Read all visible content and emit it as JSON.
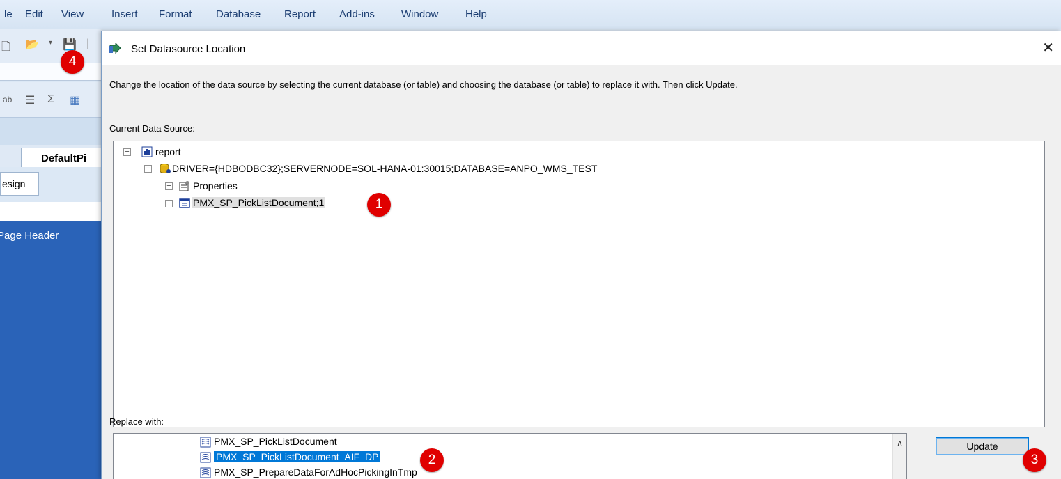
{
  "menu": [
    "le",
    "Edit",
    "View",
    "Insert",
    "Format",
    "Database",
    "Report",
    "Add-ins",
    "Window",
    "Help"
  ],
  "background_app": {
    "doc_tab": "DefaultPi",
    "design_tab": "esign",
    "section_label": "Page Header"
  },
  "dialog": {
    "title": "Set Datasource Location",
    "close_symbol": "✕",
    "description": "Change the location of the data source by selecting the current database (or table) and choosing the database (or table) to replace it with.  Then click Update.",
    "current_label": "Current Data Source:",
    "tree": {
      "root": "report",
      "connection": "DRIVER={HDBODBC32};SERVERNODE=SOL-HANA-01:30015;DATABASE=ANPO_WMS_TEST",
      "properties": "Properties",
      "table": "PMX_SP_PickListDocument;1"
    },
    "replace_label": "Replace with:",
    "replace_items": [
      "PMX_SP_PickListDocument",
      "PMX_SP_PickListDocument_AIF_DP",
      "PMX_SP_PrepareDataForAdHocPickingInTmp"
    ],
    "update_button": "Update",
    "scroll_up_symbol": "∧"
  },
  "callouts": [
    "1",
    "2",
    "3",
    "4"
  ],
  "colors": {
    "selection": "#0078d7",
    "callout": "#e00000"
  }
}
